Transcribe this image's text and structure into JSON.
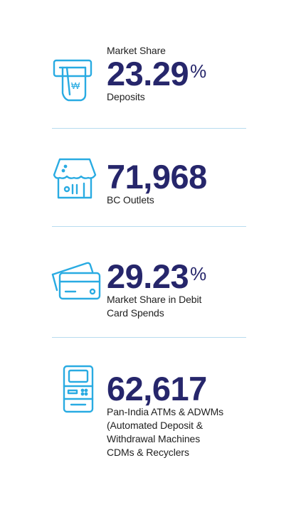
{
  "colors": {
    "accent": "#26266b",
    "icon": "#29abe2",
    "divider": "#b7dcef"
  },
  "stats": [
    {
      "icon": "atm-cash-withdrawal-icon",
      "pre_label": "Market Share",
      "value": "23.29",
      "unit": "%",
      "label": "Deposits"
    },
    {
      "icon": "shop-outlet-icon",
      "value": "71,968",
      "label": "BC Outlets"
    },
    {
      "icon": "cards-icon",
      "value": "29.23",
      "unit": "%",
      "label_lines": [
        "Market Share in Debit",
        "Card Spends"
      ]
    },
    {
      "icon": "atm-machine-icon",
      "value": "62,617",
      "label_lines": [
        "Pan-India ATMs & ADWMs",
        "(Automated Deposit &",
        "Withdrawal Machines",
        "CDMs & Recyclers"
      ]
    }
  ]
}
